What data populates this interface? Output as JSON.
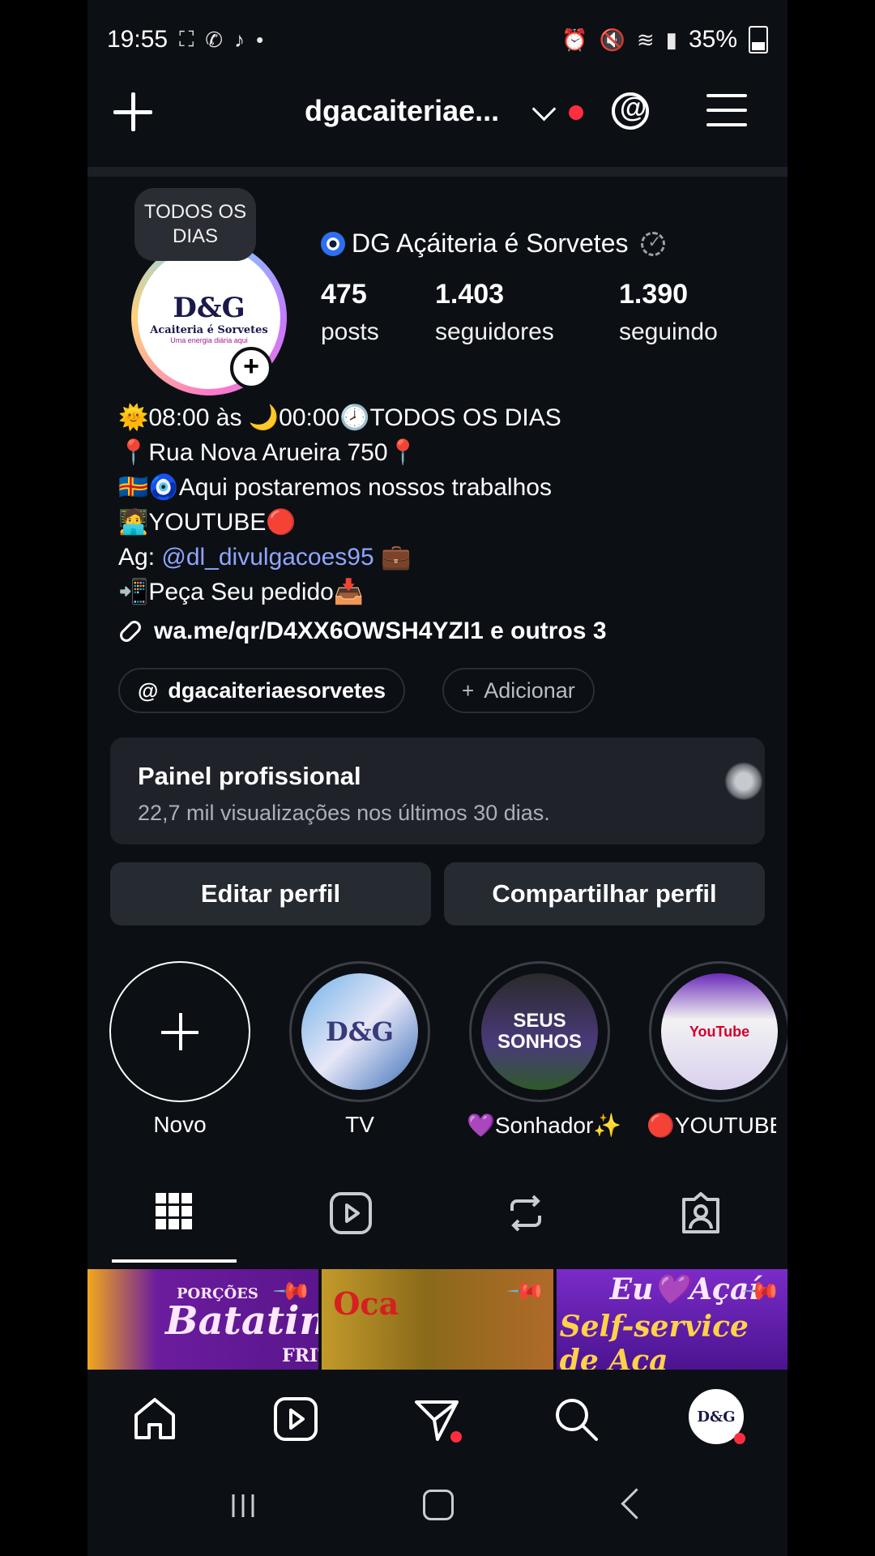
{
  "status_bar": {
    "time": "19:55",
    "battery": "35%"
  },
  "header": {
    "username": "dgacaiteriae..."
  },
  "profile": {
    "tooltip": "TODOS OS DIAS",
    "avatar_text": "D&G",
    "avatar_sub": "Acaiteria é Sorvetes",
    "avatar_tag": "Uma energia diária aqui",
    "display_name": "DG Açáiteria é Sorvetes",
    "stats": [
      {
        "num": "475",
        "label": "posts"
      },
      {
        "num": "1.403",
        "label": "seguidores"
      },
      {
        "num": "1.390",
        "label": "seguindo"
      }
    ],
    "bio": [
      "🌞08:00 às 🌙00:00🕗TODOS OS DIAS",
      "📍Rua Nova Arueira 750📍",
      "🇦🇽🧿Aqui postaremos nossos trabalhos",
      "🧑‍💻YOUTUBE🔴"
    ],
    "agency_prefix": "Ag: ",
    "agency_mention": "@dl_divulgacoes95",
    "agency_suffix": " 💼",
    "order_line": "📲Peça Seu pedido📥",
    "link": "wa.me/qr/D4XX6OWSH4YZI1 e outros 3",
    "threads_pill": "dgacaiteriaesorvetes",
    "add_pill": "Adicionar"
  },
  "panel": {
    "title": "Painel profissional",
    "subtitle": "22,7 mil visualizações nos últimos 30 dias."
  },
  "buttons": {
    "edit": "Editar perfil",
    "share": "Compartilhar perfil"
  },
  "highlights": [
    {
      "label": "Novo"
    },
    {
      "label": "TV",
      "img_text": "D&G"
    },
    {
      "label": "💜Sonhador✨",
      "img_text": "SEUS SONHOS"
    },
    {
      "label": "🔴YOUTUBE🔴",
      "img_text": "YouTube"
    }
  ],
  "grid": [
    {
      "text": "Batatinh",
      "sub": "PORÇÕES",
      "sub2": "FRITA"
    },
    {
      "text": "Oca"
    },
    {
      "text": "Self-service de Aça",
      "sub": "Eu💜Açaí"
    }
  ],
  "colors": {
    "background": "#0c0f14",
    "accent_red": "#ff2d3f",
    "mention": "#8ea6ff"
  }
}
